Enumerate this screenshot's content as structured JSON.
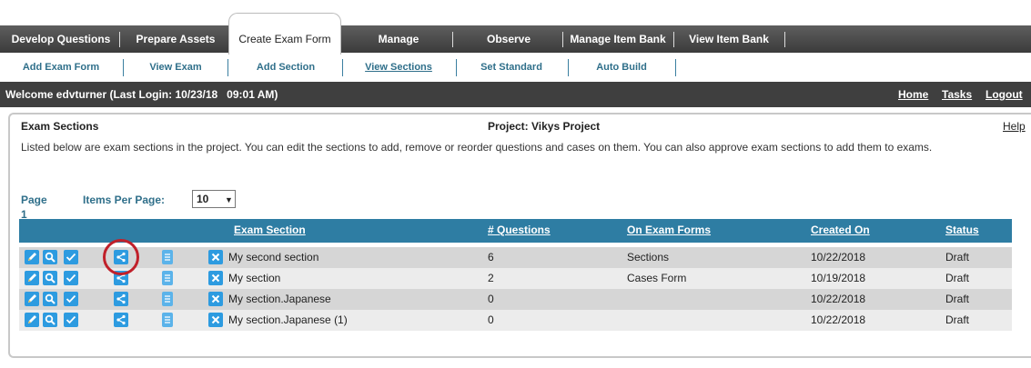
{
  "topnav": {
    "tabs": [
      {
        "label": "Develop Questions"
      },
      {
        "label": "Prepare Assets"
      },
      {
        "label": "Create Exam Form",
        "active": true
      },
      {
        "label": "Manage"
      },
      {
        "label": "Observe"
      },
      {
        "label": "Manage Item Bank"
      },
      {
        "label": "View Item Bank"
      }
    ]
  },
  "subnav": {
    "items": [
      {
        "label": "Add Exam Form"
      },
      {
        "label": "View Exam"
      },
      {
        "label": "Add Section"
      },
      {
        "label": "View Sections",
        "current": true
      },
      {
        "label": "Set Standard"
      },
      {
        "label": "Auto Build"
      }
    ]
  },
  "welcome": {
    "message": "Welcome edvturner (Last Login: 10/23/18   09:01 AM)",
    "links": {
      "home": "Home",
      "tasks": "Tasks",
      "logout": "Logout"
    }
  },
  "panel": {
    "title": "Exam Sections",
    "project": "Project: Vikys Project",
    "help": "Help",
    "description": "Listed below are exam sections in the project. You can edit the sections to add, remove or reorder questions and cases on them. You can also approve exam sections to add them to exams."
  },
  "pager": {
    "page": "Page 1",
    "items_per_page_label": "Items Per Page:",
    "items_per_page_value": "10"
  },
  "table": {
    "headers": {
      "section": "Exam Section",
      "questions": "# Questions",
      "forms": "On Exam Forms",
      "created": "Created On",
      "status": "Status"
    },
    "rows": [
      {
        "section": "My second section",
        "questions": "6",
        "forms": "Sections",
        "created": "10/22/2018",
        "status": "Draft"
      },
      {
        "section": "My section",
        "questions": "2",
        "forms": "Cases Form",
        "created": "10/19/2018",
        "status": "Draft"
      },
      {
        "section": "My section.Japanese",
        "questions": "0",
        "forms": "",
        "created": "10/22/2018",
        "status": "Draft"
      },
      {
        "section": "My section.Japanese (1)",
        "questions": "0",
        "forms": "",
        "created": "10/22/2018",
        "status": "Draft"
      }
    ]
  },
  "icons": {
    "row_actions": [
      "edit-icon",
      "view-icon",
      "approve-icon",
      "share-icon",
      "document-icon",
      "delete-icon"
    ]
  },
  "colors": {
    "header_blue": "#2e7da3",
    "link_blue": "#2f6f8a",
    "icon_blue": "#2d9be0",
    "highlight_red": "#c0202a"
  }
}
